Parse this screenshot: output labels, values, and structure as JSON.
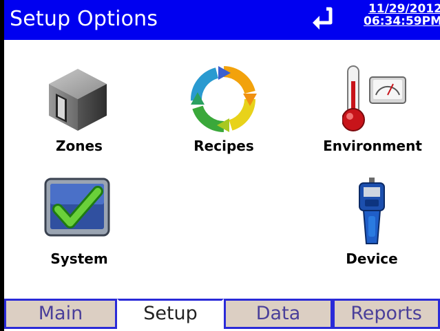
{
  "header": {
    "title": "Setup Options",
    "date": "11/29/2012",
    "time": "06:34:59PM",
    "icon": "login-arrow-icon"
  },
  "tiles": [
    {
      "label": "Zones",
      "icon": "zones-cube-icon"
    },
    {
      "label": "Recipes",
      "icon": "recipes-cycle-icon"
    },
    {
      "label": "Environment",
      "icon": "environment-thermometer-gauge-icon"
    },
    {
      "label": "System",
      "icon": "system-checkmark-icon"
    },
    {
      "label": "Device",
      "icon": "device-handheld-icon"
    }
  ],
  "tabs": [
    {
      "label": "Main",
      "active": false
    },
    {
      "label": "Setup",
      "active": true
    },
    {
      "label": "Data",
      "active": false
    },
    {
      "label": "Reports",
      "active": false
    }
  ],
  "colors": {
    "titlebar": "#0000f0",
    "tab_inactive": "#dccfc3",
    "tab_border": "#2a2ad8"
  }
}
